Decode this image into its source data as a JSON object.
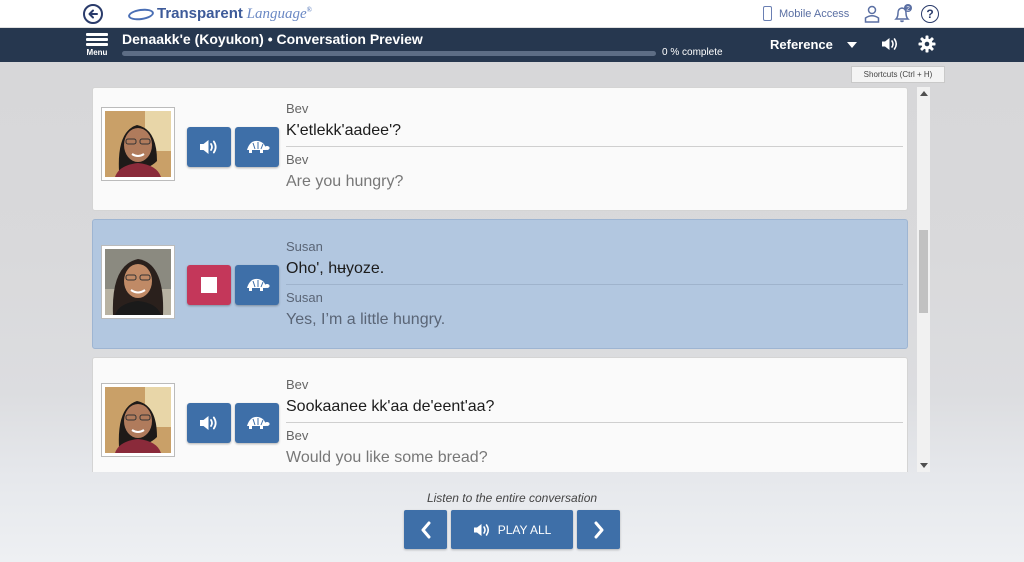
{
  "topbar": {
    "logo_brand": "Transparent",
    "logo_rest": "Language",
    "logo_mark": "®",
    "mobile_access": "Mobile Access",
    "notification_count": "2",
    "help_glyph": "?"
  },
  "navbar": {
    "menu_label": "Menu",
    "title": "Denaakk'e (Koyukon) • Conversation Preview",
    "progress_text": "0 % complete",
    "progress_value": 0,
    "reference_label": "Reference"
  },
  "tooltip": {
    "shortcuts": "Shortcuts (Ctrl + H)"
  },
  "conversation": [
    {
      "speaker": "Bev",
      "native": "K'etlekk'aadee'?",
      "speaker_translation": "Bev",
      "translation": "Are you hungry?",
      "playing": false,
      "avatar": "bev"
    },
    {
      "speaker": "Susan",
      "native": "Oho', hʉyoze.",
      "speaker_translation": "Susan",
      "translation": "Yes, I’m a little hungry.",
      "playing": true,
      "avatar": "susan"
    },
    {
      "speaker": "Bev",
      "native": "Sookaanee kk'aa de'eent'aa?",
      "speaker_translation": "Bev",
      "translation": "Would you like some bread?",
      "playing": false,
      "avatar": "bev"
    }
  ],
  "footer": {
    "hint": "Listen to the entire conversation",
    "play_all": "PLAY ALL"
  },
  "colors": {
    "navbar": "#26374f",
    "accent_button": "#3e6fa8",
    "stop_button": "#c4375a",
    "active_card": "#b2c7e0"
  }
}
